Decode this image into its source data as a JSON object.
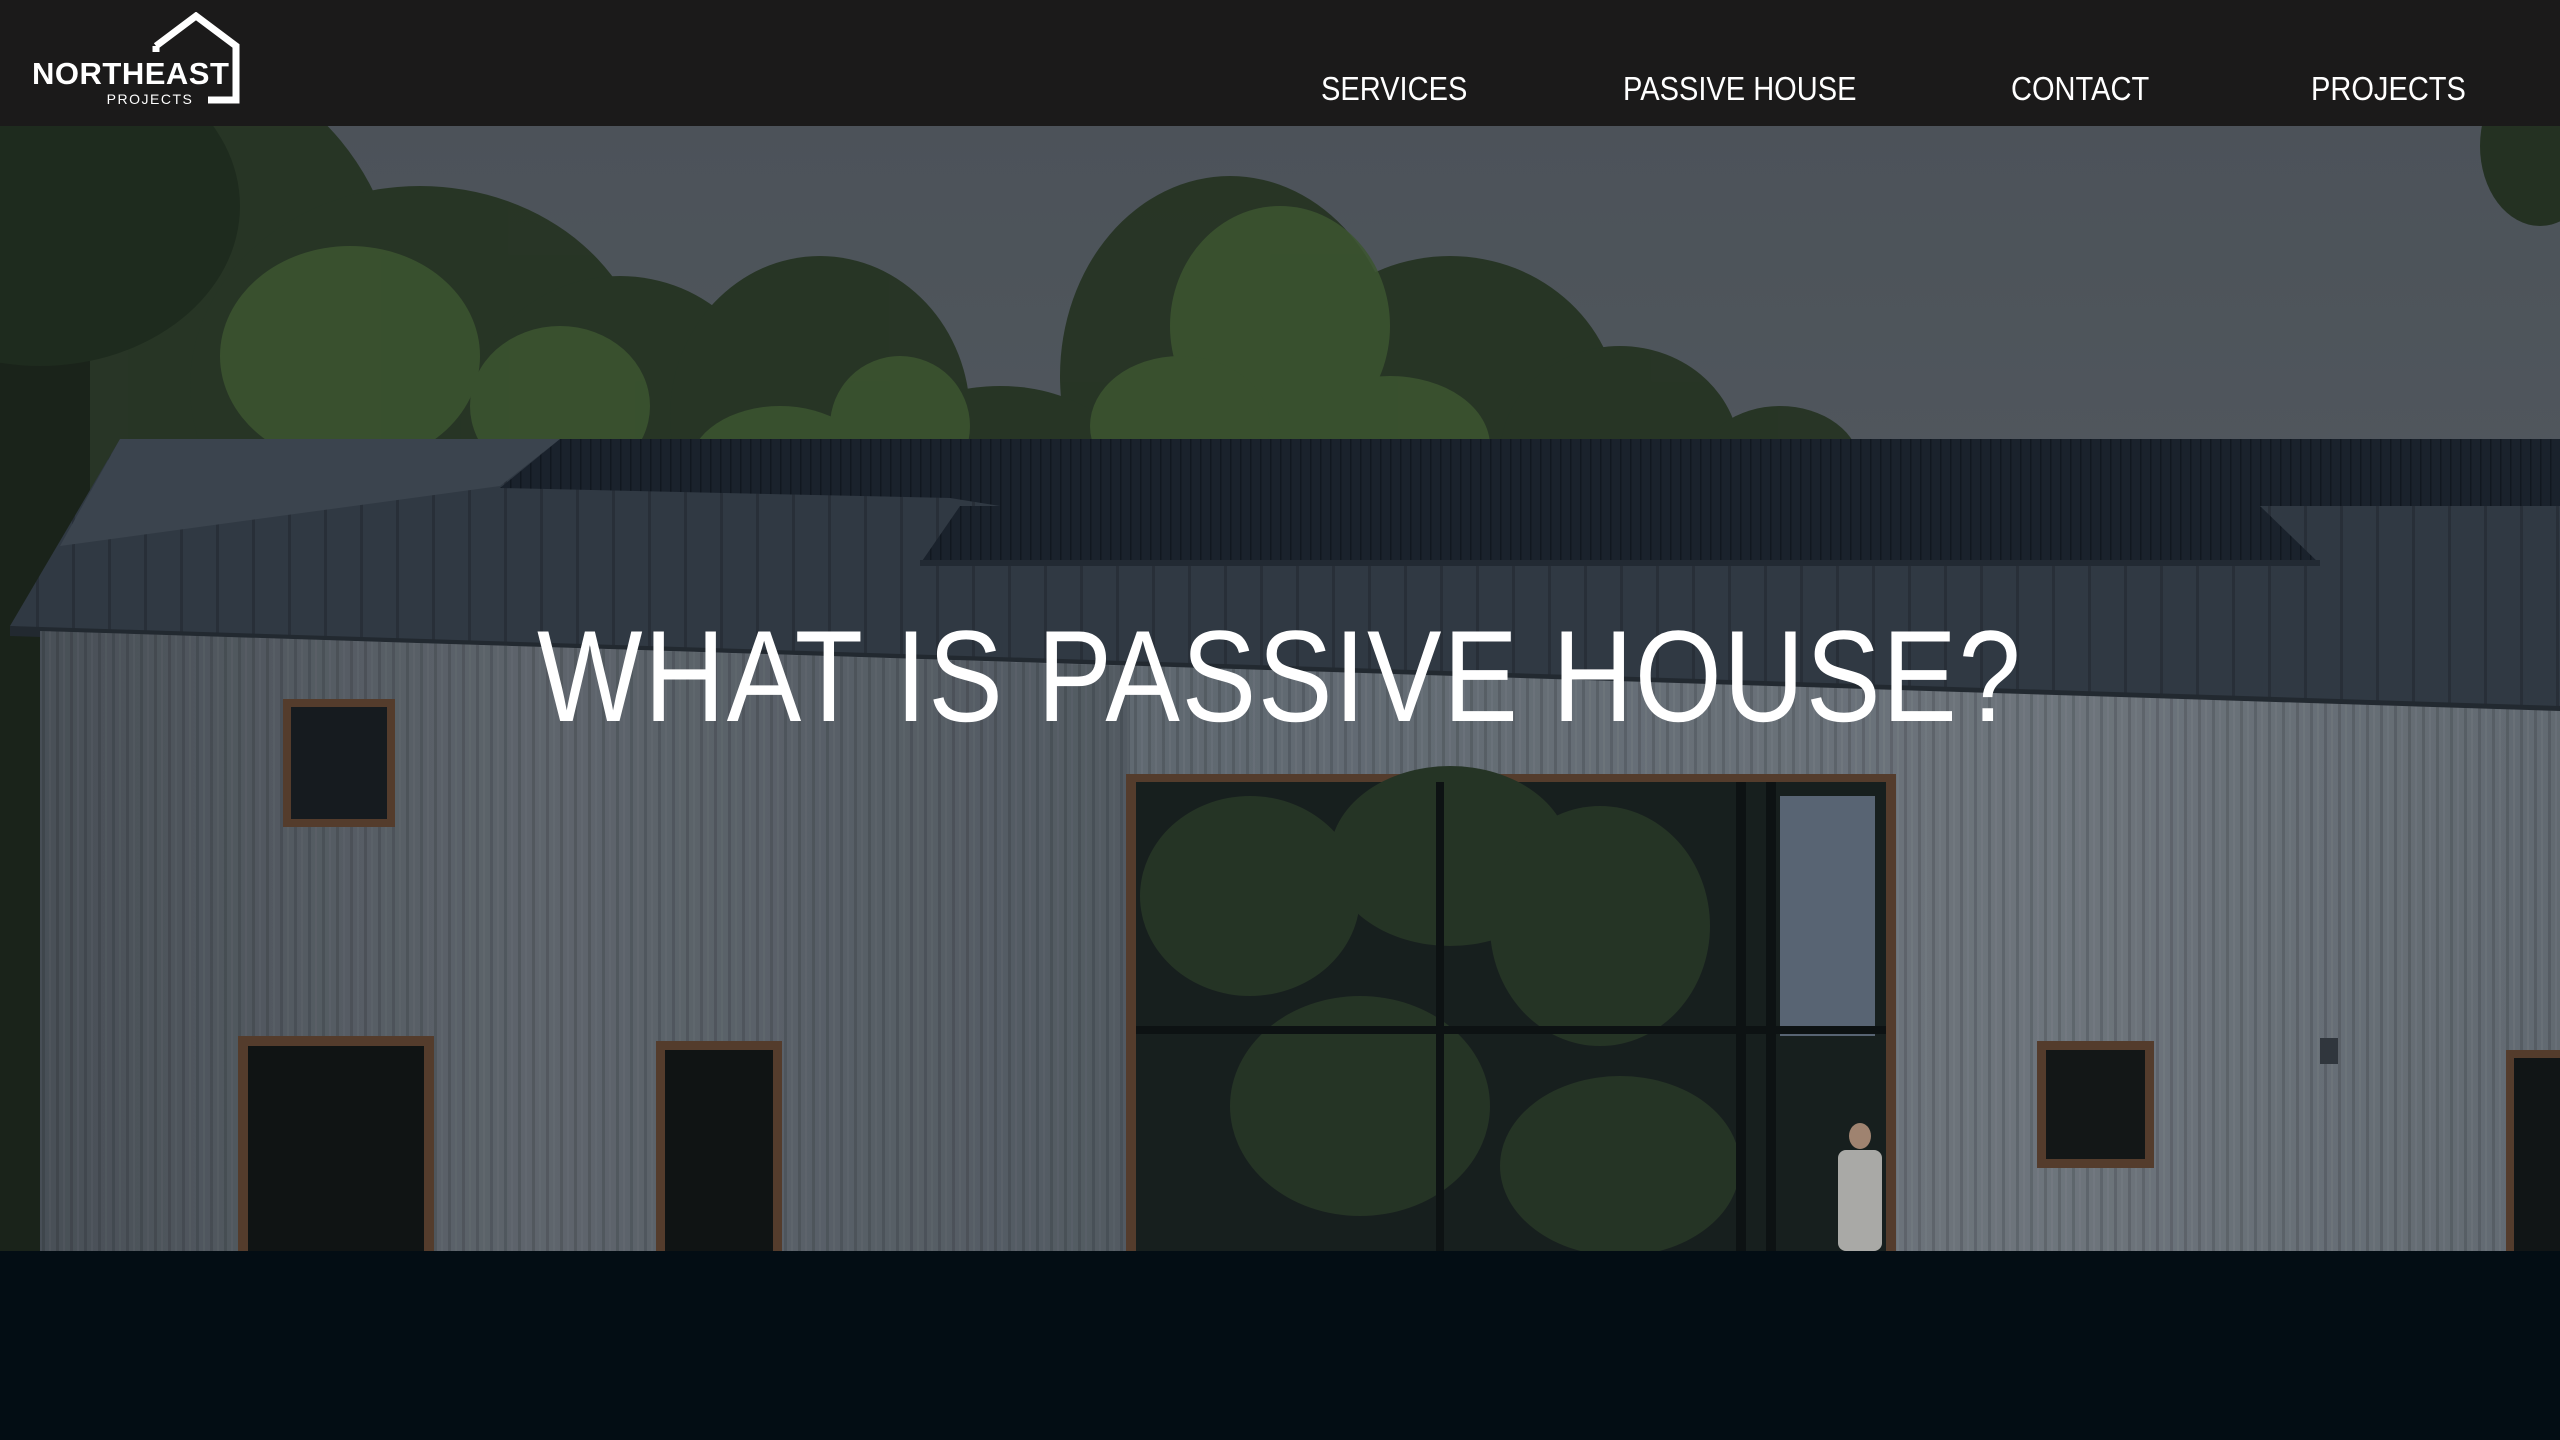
{
  "brand": {
    "name": "NORTHEAST",
    "sub": "PROJECTS"
  },
  "nav": {
    "services": "SERVICES",
    "passive_house": "PASSIVE HOUSE",
    "contact": "CONTACT",
    "projects": "PROJECTS"
  },
  "hero": {
    "title": "WHAT IS PASSIVE HOUSE?"
  },
  "colors": {
    "header_bg": "#1b1a1a",
    "page_bg": "#030d14",
    "text": "#ffffff"
  }
}
